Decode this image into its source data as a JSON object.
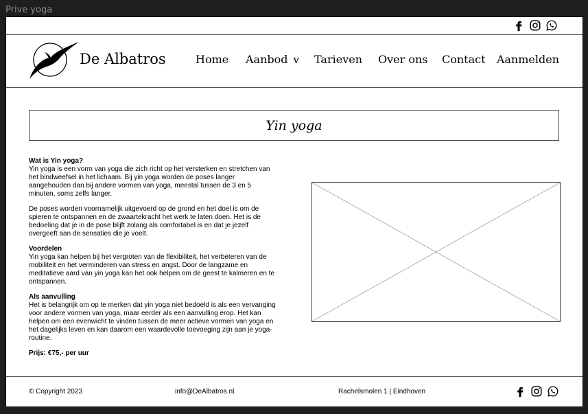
{
  "window": {
    "title": "Prive yoga"
  },
  "topbar": {
    "icons": [
      "facebook-icon",
      "instagram-icon",
      "whatsapp-icon"
    ]
  },
  "header": {
    "brand": "De Albatros",
    "logo_icon": "albatross-bird-icon",
    "nav": {
      "home": "Home",
      "aanbod": "Aanbod",
      "aanbod_chevron": "v",
      "tarieven": "Tarieven",
      "over_ons": "Over ons",
      "contact": "Contact",
      "aanmelden": "Aanmelden"
    }
  },
  "main": {
    "title": "Yin yoga",
    "sections": {
      "intro_heading": "Wat is Yin yoga?",
      "intro_text": "Yin yoga is een vorm van yoga die zich richt op het versterken en stretchen van het bindweefsel in het lichaam. Bij yin yoga worden de poses langer aangehouden dan bij andere vormen van yoga, meestal tussen de 3 en 5 minuten, soms zelfs langer.",
      "poses_text": "De poses worden voornamelijk uitgevoerd op de grond en het doel is om de spieren te ontspannen en de zwaartekracht het werk te laten doen. Het is de bedoeling dat je in de pose blijft zolang als comfortabel is en dat je jezelf overgeeft aan de sensaties die je voelt.",
      "benefits_heading": "Voordelen",
      "benefits_text": "Yin yoga kan helpen bij het vergroten van de flexibiliteit, het verbeteren van de mobiliteit en het verminderen van stress en angst. Door de langzame en meditatieve aard van yin yoga kan het ook helpen om de geest te kalmeren en te ontspannen.",
      "addition_heading": "Als aanvulling",
      "addition_text": "Het is belangrijk om op te merken dat yin yoga niet bedoeld is als een vervanging voor andere vormen van yoga, maar eerder als een aanvulling erop. Het kan helpen om een evenwicht te vinden tussen de meer actieve vormen van yoga en het dagelijks leven en kan daarom een waardevolle toevoeging zijn aan je yoga-routine.",
      "price": "Prijs: €75,- per uur"
    },
    "image_placeholder": "image-placeholder"
  },
  "footer": {
    "copyright": "© Copyright 2023",
    "email": "info@DeAlbatros.nl",
    "address": "Rachelsmolen 1 | Eindhoven",
    "icons": [
      "facebook-icon",
      "instagram-icon",
      "whatsapp-icon"
    ]
  }
}
